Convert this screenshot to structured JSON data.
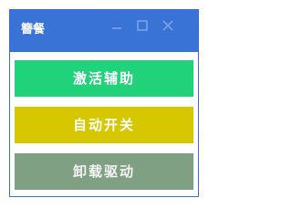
{
  "window": {
    "title": "簪餐",
    "controls": {
      "minimize_icon": "minimize-icon",
      "maximize_icon": "maximize-icon",
      "close_icon": "close-icon"
    },
    "colors": {
      "titlebar": "#3a73d6",
      "border": "#3b6fc9",
      "control_glyph": "#7ea6ec"
    }
  },
  "buttons": {
    "activate": {
      "label": "激活辅助",
      "color": "#22d27a"
    },
    "auto": {
      "label": "自动开关",
      "color": "#d6c700"
    },
    "uninstall": {
      "label": "卸载驱动",
      "color": "#7fa082"
    }
  }
}
